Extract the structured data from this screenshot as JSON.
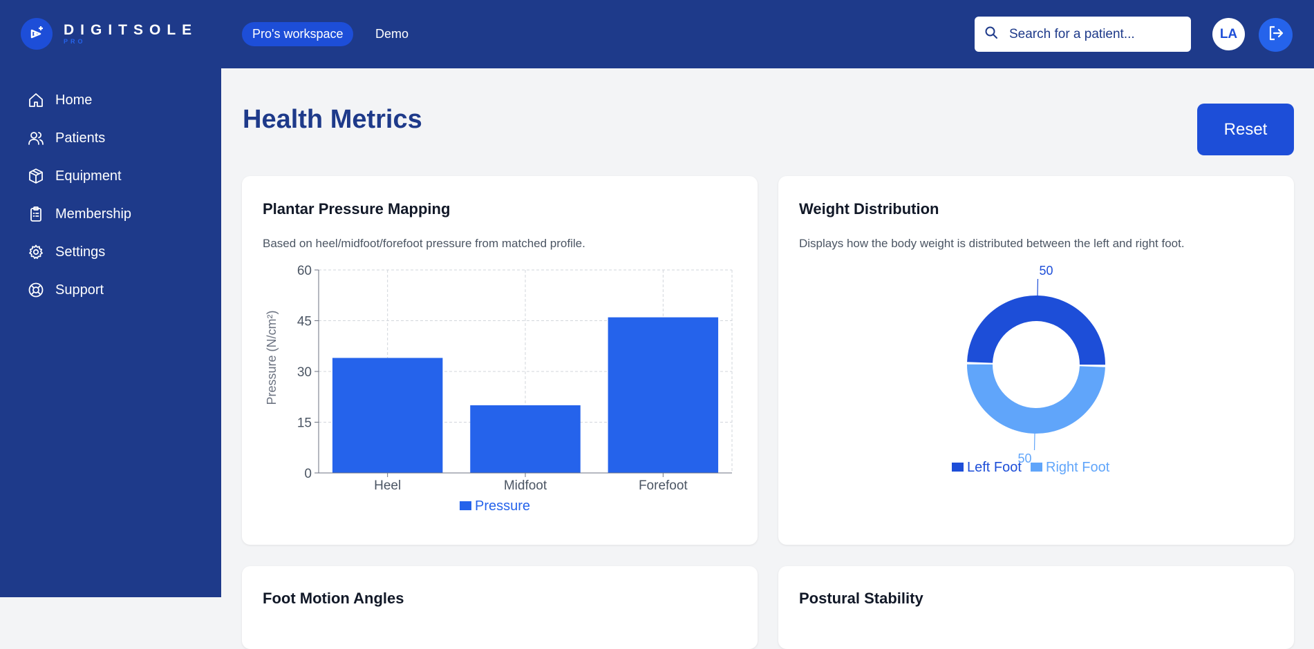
{
  "header": {
    "logo": {
      "word": "DIGITSOLE",
      "sub": "PRO"
    },
    "nav": {
      "workspace_label": "Pro's workspace",
      "demo_label": "Demo"
    },
    "search": {
      "placeholder": "Search for a patient..."
    },
    "user": {
      "initials": "LA"
    }
  },
  "sidebar": {
    "items": [
      {
        "label": "Home",
        "icon": "home-icon"
      },
      {
        "label": "Patients",
        "icon": "users-icon"
      },
      {
        "label": "Equipment",
        "icon": "box-icon"
      },
      {
        "label": "Membership",
        "icon": "clipboard-icon"
      },
      {
        "label": "Settings",
        "icon": "gear-icon"
      },
      {
        "label": "Support",
        "icon": "lifebuoy-icon"
      }
    ]
  },
  "main": {
    "title": "Health Metrics",
    "reset_label": "Reset",
    "cards": [
      {
        "title": "Plantar Pressure Mapping",
        "desc": "Based on heel/midfoot/forefoot pressure from matched profile."
      },
      {
        "title": "Weight Distribution",
        "desc": "Displays how the body weight is distributed between the left and right foot."
      },
      {
        "title": "Foot Motion Angles"
      },
      {
        "title": "Postural Stability"
      }
    ]
  },
  "colors": {
    "nav": "#1e3a8a",
    "accent": "#1d4ed8",
    "bar": "#2563eb",
    "left_foot": "#1d4ed8",
    "right_foot": "#60a5fa"
  },
  "chart_data": [
    {
      "type": "bar",
      "categories": [
        "Heel",
        "Midfoot",
        "Forefoot"
      ],
      "series": [
        {
          "name": "Pressure",
          "values": [
            34,
            20,
            46
          ]
        }
      ],
      "title": "",
      "ylabel": "Pressure (N/cm²)",
      "xlabel": "",
      "ylim": [
        0,
        60
      ],
      "yticks": [
        "0",
        "15",
        "30",
        "45",
        "60"
      ],
      "grid": true,
      "legend": "bottom"
    },
    {
      "type": "pie",
      "variant": "donut",
      "labels": [
        "Left Foot",
        "Right Foot"
      ],
      "values": [
        50,
        50
      ],
      "data_labels": [
        "50",
        "50"
      ],
      "legend": "bottom"
    }
  ]
}
